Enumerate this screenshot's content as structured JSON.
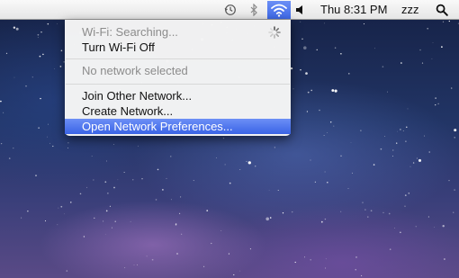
{
  "menubar": {
    "clock": "Thu 8:31 PM",
    "user": "zzz",
    "icons": {
      "time_machine": "time-machine-icon",
      "bluetooth": "bluetooth-icon",
      "wifi": "wifi-icon",
      "volume": "volume-icon",
      "spotlight": "spotlight-search-icon"
    }
  },
  "wifi_menu": {
    "status": "Wi-Fi: Searching...",
    "toggle_label": "Turn Wi-Fi Off",
    "no_network": "No network selected",
    "join_other": "Join Other Network...",
    "create_network": "Create Network...",
    "open_prefs": "Open Network Preferences..."
  },
  "colors": {
    "highlight": "#3f69e8",
    "menu_bg": "#f5f5f5",
    "disabled_text": "#8c8c8c"
  }
}
